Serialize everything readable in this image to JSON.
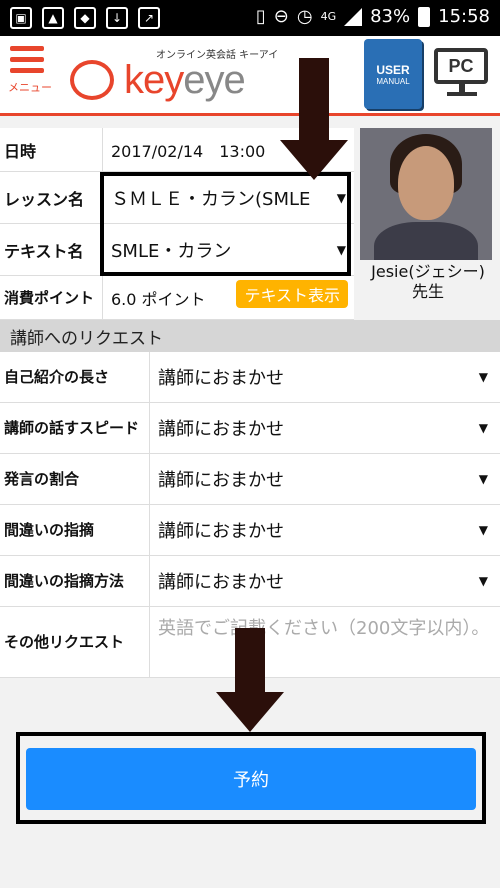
{
  "status_bar": {
    "battery": "83%",
    "time": "15:58",
    "network": "4G"
  },
  "header": {
    "menu_label": "メニュー",
    "logo_tagline": "オンライン英会話 キーアイ",
    "logo_text_1": "key",
    "logo_text_2": "eye",
    "manual_line1": "USER",
    "manual_line2": "MANUAL",
    "pc_label": "PC"
  },
  "lesson": {
    "date_label": "日時",
    "date_value": "2017/02/14　13:00",
    "lesson_label": "レッスン名",
    "lesson_value": "ＳＭＬＥ・カラン(SMLE",
    "text_label": "テキスト名",
    "text_value": "SMLE・カラン",
    "points_label": "消費ポイント",
    "points_value": "6.0 ポイント",
    "show_text_button": "テキスト表示"
  },
  "teacher": {
    "name": "Jesie(ジェシー)",
    "suffix": "先生"
  },
  "requests": {
    "heading": "講師へのリクエスト",
    "rows": [
      {
        "label": "自己紹介の長さ",
        "value": "講師におまかせ"
      },
      {
        "label": "講師の話すスピード",
        "value": "講師におまかせ"
      },
      {
        "label": "発言の割合",
        "value": "講師におまかせ"
      },
      {
        "label": "間違いの指摘",
        "value": "講師におまかせ"
      },
      {
        "label": "間違いの指摘方法",
        "value": "講師におまかせ"
      }
    ],
    "other_label": "その他リクエスト",
    "other_placeholder": "英語でご記載ください（200文字以内）。"
  },
  "reserve_button": "予約"
}
